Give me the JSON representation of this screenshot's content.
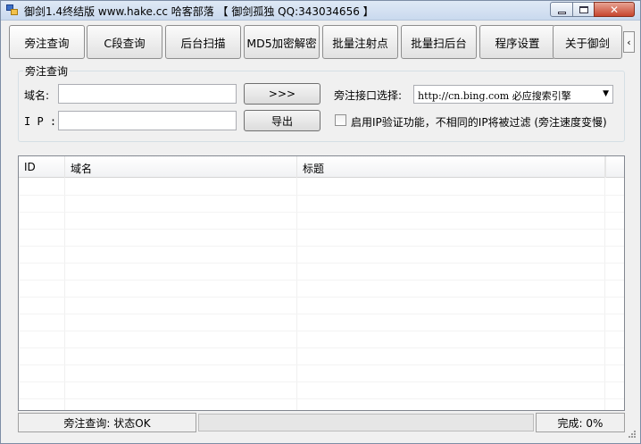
{
  "window": {
    "title": "御剑1.4终结版 www.hake.cc 哈客部落 【 御剑孤独 QQ:343034656 】",
    "controls": {
      "minimize": "minimize",
      "maximize": "maximize",
      "close": "✕"
    }
  },
  "tabs": [
    {
      "label": "旁注查询",
      "active": true
    },
    {
      "label": "C段查询"
    },
    {
      "label": "后台扫描"
    },
    {
      "label": "MD5加密解密"
    },
    {
      "label": "批量注射点"
    },
    {
      "label": "批量扫后台"
    },
    {
      "label": "程序设置"
    },
    {
      "label": "关于御剑"
    }
  ],
  "tab_scroll_glyph": "‹",
  "lookup": {
    "group_title": "旁注查询",
    "domain_label": "域名:",
    "domain_value": "",
    "ip_label": "I P :",
    "ip_value": "",
    "go_button": ">>>",
    "export_button": "导出",
    "interface_label": "旁注接口选择:",
    "interface_selected": "http://cn.bing.com   必应搜索引擎",
    "dropdown_arrow": "▼",
    "ip_check_label": "启用IP验证功能，不相同的IP将被过滤 (旁注速度变慢)",
    "ip_check_checked": false
  },
  "results": {
    "columns": [
      "ID",
      "域名",
      "标题"
    ],
    "rows": []
  },
  "status": {
    "left_text": "旁注查询: 状态OK",
    "progress_percent": 0,
    "right_text": "完成: 0%"
  }
}
